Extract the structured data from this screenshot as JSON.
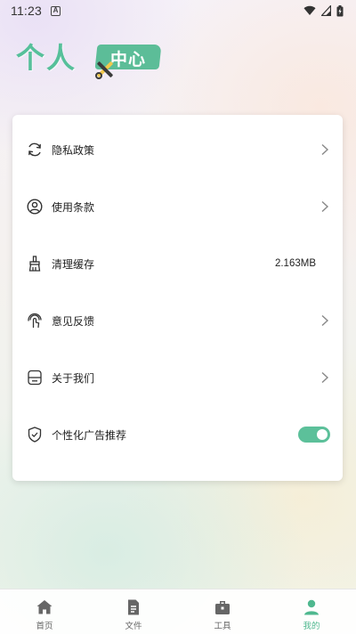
{
  "status_bar": {
    "time": "11:23",
    "notification_letter": "A",
    "icons": [
      "wifi-icon",
      "signal-icon",
      "battery-icon"
    ]
  },
  "header": {
    "title_main": "个人",
    "title_badge": "中心",
    "accent_color": "#5cbd98"
  },
  "settings": {
    "items": [
      {
        "label": "隐私政策",
        "icon": "sync-icon",
        "trailing": "chevron"
      },
      {
        "label": "使用条款",
        "icon": "user-circle-icon",
        "trailing": "chevron"
      },
      {
        "label": "清理缓存",
        "icon": "brush-icon",
        "trailing": "value",
        "value": "2.163MB"
      },
      {
        "label": "意见反馈",
        "icon": "touch-icon",
        "trailing": "chevron"
      },
      {
        "label": "关于我们",
        "icon": "info-box-icon",
        "trailing": "chevron"
      },
      {
        "label": "个性化广告推荐",
        "icon": "shield-check-icon",
        "trailing": "toggle",
        "toggle_on": true
      }
    ]
  },
  "bottom_nav": {
    "items": [
      {
        "label": "首页",
        "icon": "home-icon",
        "active": false
      },
      {
        "label": "文件",
        "icon": "document-icon",
        "active": false
      },
      {
        "label": "工具",
        "icon": "toolbox-icon",
        "active": false
      },
      {
        "label": "我的",
        "icon": "person-icon",
        "active": true
      }
    ],
    "active_color": "#4fb88f"
  }
}
